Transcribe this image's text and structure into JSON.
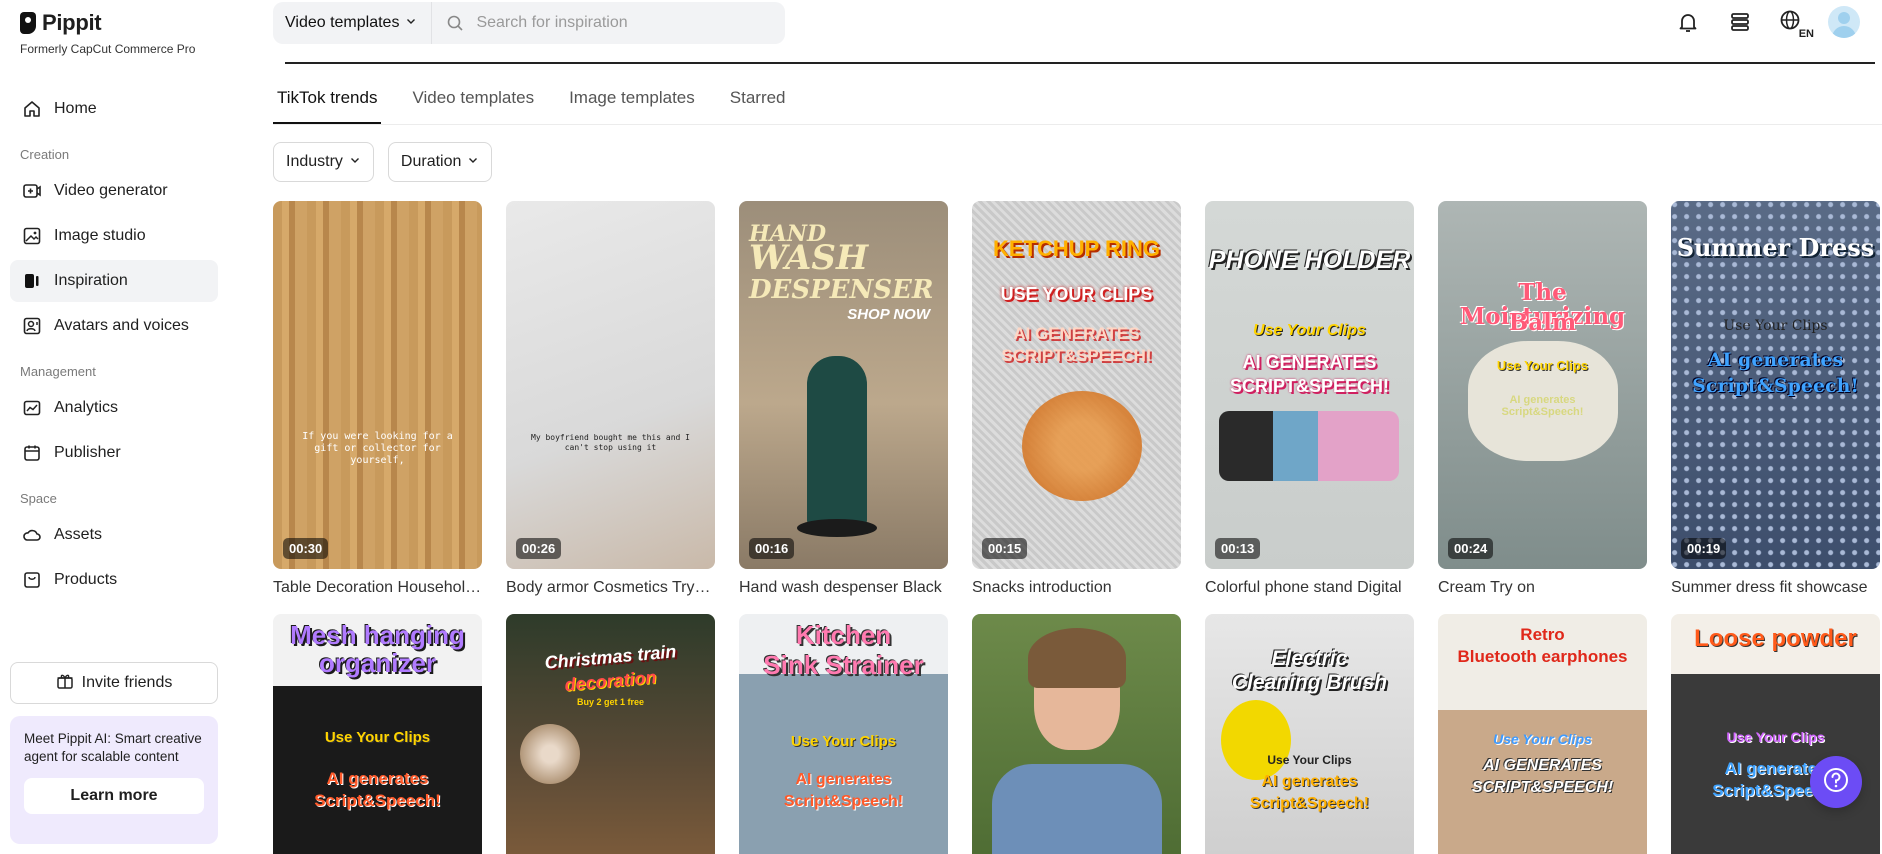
{
  "brand": {
    "name": "Pippit",
    "tagline": "Formerly CapCut Commerce Pro"
  },
  "nav": {
    "home": "Home",
    "creation_label": "Creation",
    "video_generator": "Video generator",
    "image_studio": "Image studio",
    "inspiration": "Inspiration",
    "avatars_voices": "Avatars and voices",
    "management_label": "Management",
    "analytics": "Analytics",
    "publisher": "Publisher",
    "space_label": "Space",
    "assets": "Assets",
    "products": "Products"
  },
  "invite": {
    "label": "Invite friends"
  },
  "promo": {
    "text": "Meet Pippit AI: Smart creative agent for scalable content",
    "button": "Learn more"
  },
  "search": {
    "scope": "Video templates",
    "placeholder": "Search for inspiration"
  },
  "lang": "EN",
  "tabs": [
    "TikTok trends",
    "Video templates",
    "Image templates",
    "Starred"
  ],
  "filters": {
    "industry": "Industry",
    "duration": "Duration"
  },
  "row1": [
    {
      "duration": "00:30",
      "title": "Table Decoration Household Items",
      "caption": "If you were looking for a gift or collector for yourself,"
    },
    {
      "duration": "00:26",
      "title": "Body armor Cosmetics Try-on",
      "caption": "My boyfriend bought me this and I can't stop using it"
    },
    {
      "duration": "00:16",
      "title": "Hand wash despenser Black",
      "overlay": [
        "HAND",
        "WASH",
        "DESPENSER",
        "SHOP NOW"
      ]
    },
    {
      "duration": "00:15",
      "title": "Snacks introduction",
      "overlay": [
        "KETCHUP RING",
        "USE YOUR CLIPS",
        "AI GENERATES",
        "SCRIPT&SPEECH!"
      ]
    },
    {
      "duration": "00:13",
      "title": "Colorful phone stand Digital",
      "overlay": [
        "PHONE HOLDER",
        "Use Your Clips",
        "AI GENERATES",
        "SCRIPT&SPEECH!"
      ]
    },
    {
      "duration": "00:24",
      "title": "Cream Try on",
      "overlay": [
        "The Moisturizing",
        "Balm",
        "Use Your Clips",
        "AI generates Script&Speech!"
      ]
    },
    {
      "duration": "00:19",
      "title": "Summer dress fit showcase",
      "overlay": [
        "Summer Dress",
        "Use Your Clips",
        "AI generates",
        "Script&Speech!"
      ]
    }
  ],
  "row2": [
    {
      "overlay": [
        "Mesh hanging",
        "organizer",
        "Use Your Clips",
        "AI generates",
        "Script&Speech!"
      ]
    },
    {
      "overlay": [
        "Christmas train",
        "decoration",
        "Buy 2 get 1 free"
      ]
    },
    {
      "overlay": [
        "Kitchen",
        "Sink Strainer",
        "Use Your Clips",
        "AI generates",
        "Script&Speech!"
      ]
    },
    {
      "overlay": []
    },
    {
      "overlay": [
        "Electric",
        "Cleaning Brush",
        "Use Your Clips",
        "AI generates",
        "Script&Speech!"
      ]
    },
    {
      "overlay": [
        "Retro",
        "Bluetooth earphones",
        "Use Your Clips",
        "AI GENERATES",
        "SCRIPT&SPEECH!"
      ]
    },
    {
      "overlay": [
        "Loose powder",
        "Use Your Clips",
        "AI generates",
        "Script&Speech!"
      ]
    }
  ]
}
